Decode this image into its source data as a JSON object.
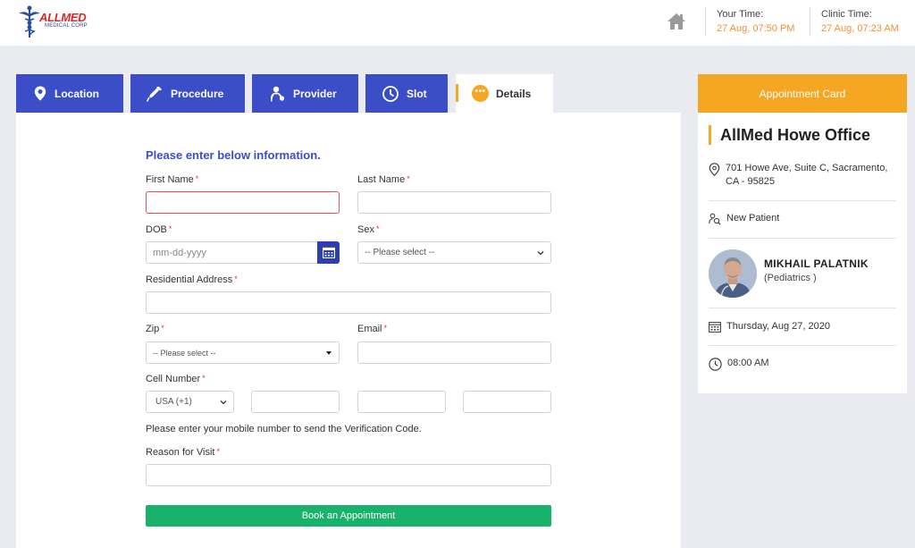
{
  "header": {
    "logo_main": "ALLMED",
    "logo_sub": "MEDICAL CORP",
    "your_time_label": "Your Time:",
    "your_time_value": "27 Aug, 07:50 PM",
    "clinic_time_label": "Clinic Time:",
    "clinic_time_value": "27 Aug, 07:23 AM"
  },
  "tabs": [
    {
      "label": "Location",
      "icon": "map-pin-icon"
    },
    {
      "label": "Procedure",
      "icon": "syringe-icon"
    },
    {
      "label": "Provider",
      "icon": "doctor-icon"
    },
    {
      "label": "Slot",
      "icon": "clock-icon"
    },
    {
      "label": "Details",
      "icon": "more-dots-icon",
      "active": true
    }
  ],
  "form": {
    "heading": "Please enter below information.",
    "first_name_label": "First Name",
    "last_name_label": "Last Name",
    "dob_label": "DOB",
    "dob_placeholder": "mm-dd-yyyy",
    "sex_label": "Sex",
    "sex_value": "-- Please select --",
    "address_label": "Residential Address",
    "zip_label": "Zip",
    "zip_value": "-- Please select --",
    "email_label": "Email",
    "cell_label": "Cell Number",
    "country_code": "USA (+1)",
    "cell_note": "Please enter your mobile number to send the Verification Code.",
    "reason_label": "Reason for Visit",
    "required_mark": "*",
    "submit_label": "Book an Appointment"
  },
  "card": {
    "title": "Appointment Card",
    "office": "AllMed Howe Office",
    "address": "701 Howe Ave, Suite C, Sacramento, CA - 95825",
    "patient_type": "New Patient",
    "doctor_name": "MIKHAIL PALATNIK",
    "doctor_specialty": "(Pediatrics )",
    "date": "Thursday, Aug 27, 2020",
    "time": "08:00 AM"
  },
  "colors": {
    "primary": "#3b4ec8",
    "accent": "#f5a623",
    "success": "#19b26b",
    "error": "#e35454"
  }
}
